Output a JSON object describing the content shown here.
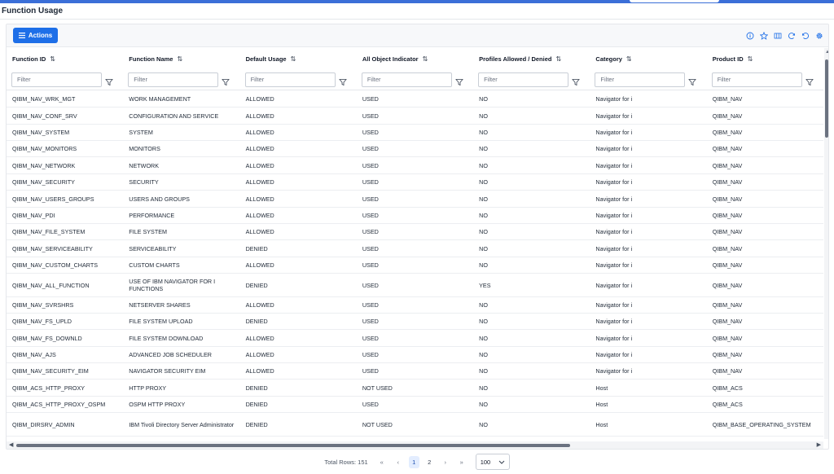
{
  "page": {
    "title": "Function Usage"
  },
  "toolbar": {
    "actions_label": "Actions",
    "icons": [
      "info-icon",
      "star-icon",
      "column-settings-icon",
      "refresh-icon",
      "reset-icon",
      "gear-icon"
    ]
  },
  "columns": [
    {
      "label": "Function ID"
    },
    {
      "label": "Function Name"
    },
    {
      "label": "Default Usage"
    },
    {
      "label": "All Object Indicator"
    },
    {
      "label": "Profiles Allowed / Denied"
    },
    {
      "label": "Category"
    },
    {
      "label": "Product ID"
    }
  ],
  "filter": {
    "placeholder": "Filter"
  },
  "rows": [
    [
      "QIBM_NAV_WRK_MGT",
      "WORK MANAGEMENT",
      "ALLOWED",
      "USED",
      "NO",
      "Navigator for i",
      "QIBM_NAV"
    ],
    [
      "QIBM_NAV_CONF_SRV",
      "CONFIGURATION AND SERVICE",
      "ALLOWED",
      "USED",
      "NO",
      "Navigator for i",
      "QIBM_NAV"
    ],
    [
      "QIBM_NAV_SYSTEM",
      "SYSTEM",
      "ALLOWED",
      "USED",
      "NO",
      "Navigator for i",
      "QIBM_NAV"
    ],
    [
      "QIBM_NAV_MONITORS",
      "MONITORS",
      "ALLOWED",
      "USED",
      "NO",
      "Navigator for i",
      "QIBM_NAV"
    ],
    [
      "QIBM_NAV_NETWORK",
      "NETWORK",
      "ALLOWED",
      "USED",
      "NO",
      "Navigator for i",
      "QIBM_NAV"
    ],
    [
      "QIBM_NAV_SECURITY",
      "SECURITY",
      "ALLOWED",
      "USED",
      "NO",
      "Navigator for i",
      "QIBM_NAV"
    ],
    [
      "QIBM_NAV_USERS_GROUPS",
      "USERS AND GROUPS",
      "ALLOWED",
      "USED",
      "NO",
      "Navigator for i",
      "QIBM_NAV"
    ],
    [
      "QIBM_NAV_PDI",
      "PERFORMANCE",
      "ALLOWED",
      "USED",
      "NO",
      "Navigator for i",
      "QIBM_NAV"
    ],
    [
      "QIBM_NAV_FILE_SYSTEM",
      "FILE SYSTEM",
      "ALLOWED",
      "USED",
      "NO",
      "Navigator for i",
      "QIBM_NAV"
    ],
    [
      "QIBM_NAV_SERVICEABILITY",
      "SERVICEABILITY",
      "DENIED",
      "USED",
      "NO",
      "Navigator for i",
      "QIBM_NAV"
    ],
    [
      "QIBM_NAV_CUSTOM_CHARTS",
      "CUSTOM CHARTS",
      "ALLOWED",
      "USED",
      "NO",
      "Navigator for i",
      "QIBM_NAV"
    ],
    [
      "QIBM_NAV_ALL_FUNCTION",
      "USE OF IBM NAVIGATOR FOR I FUNCTIONS",
      "DENIED",
      "USED",
      "YES",
      "Navigator for i",
      "QIBM_NAV"
    ],
    [
      "QIBM_NAV_SVRSHRS",
      "NETSERVER SHARES",
      "ALLOWED",
      "USED",
      "NO",
      "Navigator for i",
      "QIBM_NAV"
    ],
    [
      "QIBM_NAV_FS_UPLD",
      "FILE SYSTEM UPLOAD",
      "DENIED",
      "USED",
      "NO",
      "Navigator for i",
      "QIBM_NAV"
    ],
    [
      "QIBM_NAV_FS_DOWNLD",
      "FILE SYSTEM DOWNLOAD",
      "ALLOWED",
      "USED",
      "NO",
      "Navigator for i",
      "QIBM_NAV"
    ],
    [
      "QIBM_NAV_AJS",
      "ADVANCED JOB SCHEDULER",
      "ALLOWED",
      "USED",
      "NO",
      "Navigator for i",
      "QIBM_NAV"
    ],
    [
      "QIBM_NAV_SECURITY_EIM",
      "NAVIGATOR SECURITY EIM",
      "ALLOWED",
      "USED",
      "NO",
      "Navigator for i",
      "QIBM_NAV"
    ],
    [
      "QIBM_ACS_HTTP_PROXY",
      "HTTP PROXY",
      "DENIED",
      "NOT USED",
      "NO",
      "Host",
      "QIBM_ACS"
    ],
    [
      "QIBM_ACS_HTTP_PROXY_OSPM",
      "OSPM HTTP PROXY",
      "DENIED",
      "USED",
      "NO",
      "Host",
      "QIBM_ACS"
    ],
    [
      "QIBM_DIRSRV_ADMIN",
      "IBM Tivoli Directory Server Administrator",
      "DENIED",
      "NOT USED",
      "NO",
      "Host",
      "QIBM_BASE_OPERATING_SYSTEM"
    ]
  ],
  "pagination": {
    "total_label": "Total Rows: 151",
    "pages": [
      "1",
      "2"
    ],
    "current_page": "1",
    "page_size": "100"
  }
}
